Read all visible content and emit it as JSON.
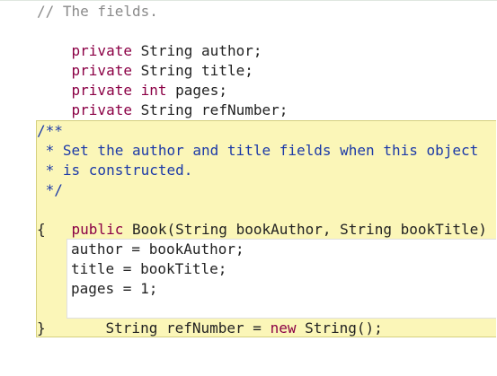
{
  "fields_comment": "// The fields.",
  "fields": [
    {
      "modifier": "private",
      "type": "String",
      "name": "author;"
    },
    {
      "modifier": "private",
      "type": "String",
      "name": "title;"
    },
    {
      "modifier": "private",
      "type": "int",
      "name": "pages;"
    },
    {
      "modifier": "private",
      "type": "String",
      "name": "refNumber;"
    }
  ],
  "doc_comment": {
    "open": "/**",
    "lines": [
      " * Set the author and title fields when this object",
      " * is constructed."
    ],
    "close": " */"
  },
  "constructor": {
    "modifier": "public",
    "signature": "Book(String bookAuthor, String bookTitle)",
    "open_brace": "{",
    "close_brace": "}",
    "body": [
      "author = bookAuthor;",
      "title = bookTitle;",
      "pages = 1;",
      "String refNumber = ",
      "new",
      " String();"
    ]
  }
}
